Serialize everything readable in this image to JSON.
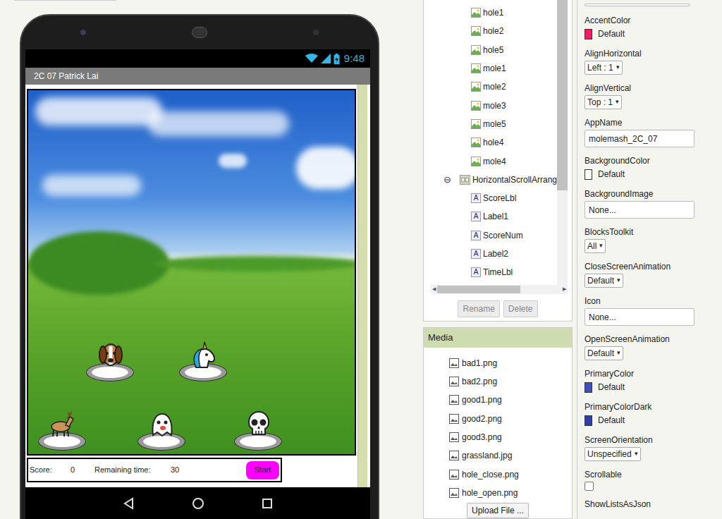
{
  "phone": {
    "status_time": "9:48",
    "title": "2C 07 Patrick Lai",
    "sprites": [
      {
        "kind": "dog"
      },
      {
        "kind": "unicorn"
      },
      {
        "kind": "deer"
      },
      {
        "kind": "ghost"
      },
      {
        "kind": "skull"
      }
    ],
    "score_label": "Score:",
    "score": "0",
    "time_label": "Remaining time:",
    "time": "30",
    "start_button": "Start"
  },
  "components": {
    "label_icon": "A",
    "toggle": "⊖",
    "items": [
      {
        "label": "hole1",
        "kind": "image",
        "depth": 2
      },
      {
        "label": "hole2",
        "kind": "image",
        "depth": 2
      },
      {
        "label": "hole5",
        "kind": "image",
        "depth": 2
      },
      {
        "label": "mole1",
        "kind": "image",
        "depth": 2
      },
      {
        "label": "mole2",
        "kind": "image",
        "depth": 2
      },
      {
        "label": "mole3",
        "kind": "image",
        "depth": 2
      },
      {
        "label": "mole5",
        "kind": "image",
        "depth": 2
      },
      {
        "label": "hole4",
        "kind": "image",
        "depth": 2
      },
      {
        "label": "mole4",
        "kind": "image",
        "depth": 2
      },
      {
        "label": "HorizontalScrollArrang",
        "kind": "arrangement",
        "depth": 1,
        "expanded": true
      },
      {
        "label": "ScoreLbl",
        "kind": "label",
        "depth": 2
      },
      {
        "label": "Label1",
        "kind": "label",
        "depth": 2
      },
      {
        "label": "ScoreNum",
        "kind": "label",
        "depth": 2
      },
      {
        "label": "Label2",
        "kind": "label",
        "depth": 2
      },
      {
        "label": "TimeLbl",
        "kind": "label",
        "depth": 2
      }
    ],
    "buttons": [
      {
        "label": "Rename",
        "disabled": true
      },
      {
        "label": "Delete",
        "disabled": true
      }
    ]
  },
  "media": {
    "title": "Media",
    "files": [
      "bad1.png",
      "bad2.png",
      "good1.png",
      "good2.png",
      "good3.png",
      "grassland.jpg",
      "hole_close.png",
      "hole_open.png"
    ],
    "upload_button": "Upload File ..."
  },
  "properties": {
    "arrow": "▾",
    "items": [
      {
        "label": "AccentColor",
        "kind": "color",
        "value": "Default",
        "color": "#e91e63"
      },
      {
        "label": "AlignHorizontal",
        "kind": "dropdown",
        "value": "Left : 1"
      },
      {
        "label": "AlignVertical",
        "kind": "dropdown",
        "value": "Top : 1"
      },
      {
        "label": "AppName",
        "kind": "text",
        "value": "molemash_2C_07"
      },
      {
        "label": "BackgroundColor",
        "kind": "color",
        "value": "Default",
        "color": "#ffffff"
      },
      {
        "label": "BackgroundImage",
        "kind": "text",
        "value": "None..."
      },
      {
        "label": "BlocksToolkit",
        "kind": "dropdown",
        "value": "All"
      },
      {
        "label": "CloseScreenAnimation",
        "kind": "dropdown",
        "value": "Default"
      },
      {
        "label": "Icon",
        "kind": "text",
        "value": "None..."
      },
      {
        "label": "OpenScreenAnimation",
        "kind": "dropdown",
        "value": "Default"
      },
      {
        "label": "PrimaryColor",
        "kind": "color",
        "value": "Default",
        "color": "#3f51b5"
      },
      {
        "label": "PrimaryColorDark",
        "kind": "color",
        "value": "Default",
        "color": "#303f9f"
      },
      {
        "label": "ScreenOrientation",
        "kind": "dropdown",
        "value": "Unspecified"
      },
      {
        "label": "Scrollable",
        "kind": "checkbox",
        "checked": false
      },
      {
        "label": "ShowListsAsJson",
        "kind": "heading"
      }
    ]
  }
}
